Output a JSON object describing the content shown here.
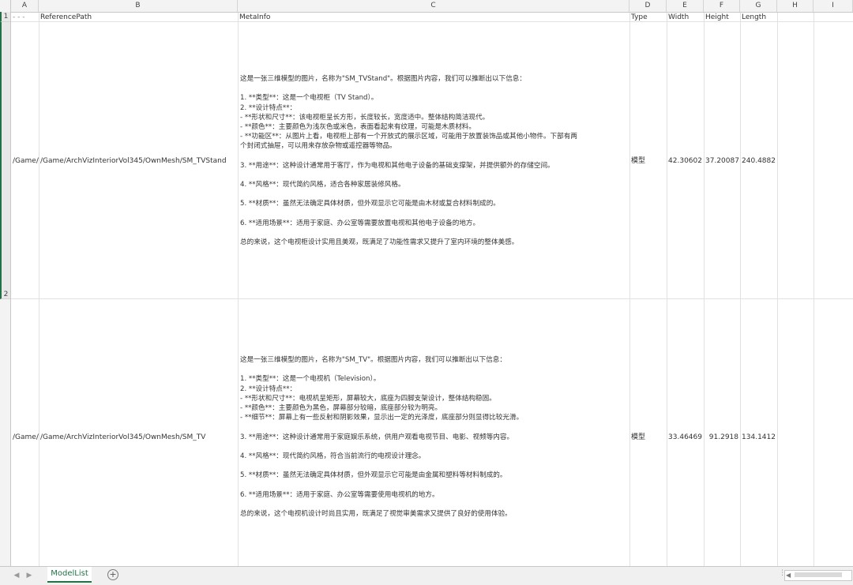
{
  "columns": [
    "A",
    "B",
    "C",
    "D",
    "E",
    "F",
    "G",
    "H",
    "I"
  ],
  "row_numbers": [
    "1",
    "2"
  ],
  "header": {
    "a": "- - -",
    "b": "ReferencePath",
    "c": "MetaInfo",
    "d": "Type",
    "e": "Width",
    "f": "Height",
    "g": "Length"
  },
  "rows": [
    {
      "a": "/Game/",
      "b": "/Game/ArchVizInteriorVol345/OwnMesh/SM_TVStand",
      "d": "模型",
      "e": "42.30602",
      "f": "37.20087",
      "g": "240.4882",
      "meta": [
        "这是一张三维模型的图片，名称为\"SM_TVStand\"。根据图片内容，我们可以推断出以下信息：",
        "",
        "1. **类型**：这是一个电视柜（TV Stand）。",
        "2. **设计特点**：",
        "   - **形状和尺寸**：该电视柜呈长方形，长度较长，宽度适中。整体结构简洁现代。",
        "   - **颜色**：主要颜色为浅灰色或米色，表面看起来有纹理，可能是木质材料。",
        "   - **功能区**：从图片上看，电视柜上部有一个开放式的展示区域，可能用于放置装饰品或其他小物件。下部有两",
        "个封闭式抽屉，可以用来存放杂物或遥控器等物品。",
        "",
        "3. **用途**：这种设计通常用于客厅，作为电视和其他电子设备的基础支撑架，并提供额外的存储空间。",
        "",
        "4. **风格**：现代简约风格，适合各种家居装修风格。",
        "",
        "5. **材质**：虽然无法确定具体材质，但外观显示它可能是由木材或复合材料制成的。",
        "",
        "6. **适用场景**：适用于家庭、办公室等需要放置电视和其他电子设备的地方。",
        "",
        "总的来说，这个电视柜设计实用且美观，既满足了功能性需求又提升了室内环境的整体美感。"
      ]
    },
    {
      "a": "/Game/",
      "b": "/Game/ArchVizInteriorVol345/OwnMesh/SM_TV",
      "d": "模型",
      "e": "33.46469",
      "f": "91.2918",
      "g": "134.1412",
      "meta": [
        "这是一张三维模型的图片，名称为\"SM_TV\"。根据图片内容，我们可以推断出以下信息：",
        "",
        "1. **类型**：这是一个电视机（Television）。",
        "2. **设计特点**：",
        "   - **形状和尺寸**：电视机呈矩形，屏幕较大，底座为四脚支架设计，整体结构稳固。",
        "   - **颜色**：主要颜色为黑色，屏幕部分较暗，底座部分较为明亮。",
        "   - **细节**：屏幕上有一些反射和阴影效果，显示出一定的光泽度，底座部分则显得比较光滑。",
        "",
        "3. **用途**：这种设计通常用于家庭娱乐系统，供用户观看电视节目、电影、视频等内容。",
        "",
        "4. **风格**：现代简约风格，符合当前流行的电视设计理念。",
        "",
        "5. **材质**：虽然无法确定具体材质，但外观显示它可能是由金属和塑料等材料制成的。",
        "",
        "6. **适用场景**：适用于家庭、办公室等需要使用电视机的地方。",
        "",
        "总的来说，这个电视机设计时尚且实用，既满足了视觉审美需求又提供了良好的使用体验。"
      ]
    }
  ],
  "sheet_tab": "ModelList",
  "add_sheet_icon": "plus-circle-icon",
  "colors": {
    "accent": "#217346",
    "header_bg": "#f3f3f3",
    "grid": "#e1e1e1"
  }
}
